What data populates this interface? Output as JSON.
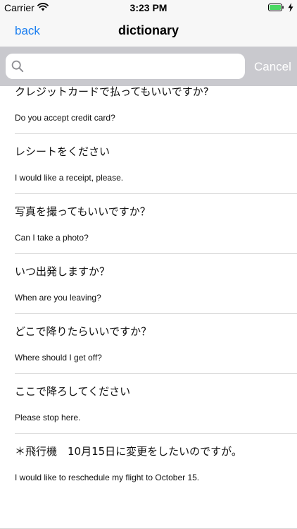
{
  "status_bar": {
    "carrier": "Carrier",
    "time": "3:23 PM"
  },
  "nav": {
    "back_label": "back",
    "title": "dictionary"
  },
  "search": {
    "value": "",
    "placeholder": "",
    "cancel_label": "Cancel"
  },
  "phrases": [
    {
      "jp": "クレジットカードで払ってもいいですか?",
      "en": "Do you accept credit card?"
    },
    {
      "jp": "レシートをください",
      "en": "I would like a receipt, please."
    },
    {
      "jp": "写真を撮ってもいいですか？",
      "en": "Can I take a photo?"
    },
    {
      "jp": "いつ出発しますか？",
      "en": "When are you leaving?"
    },
    {
      "jp": "どこで降りたらいいですか？",
      "en": "Where should I get off?"
    },
    {
      "jp": "ここで降ろしてください",
      "en": "Please stop here."
    },
    {
      "jp": "＊飛行機　10月15日に変更をしたいのですが。",
      "en": "I would like to reschedule my flight to October 15."
    }
  ],
  "colors": {
    "accent": "#1a7ef0",
    "battery": "#4cd964",
    "search_bar_bg": "#c9c9ce"
  },
  "icons": {
    "wifi": "wifi-icon",
    "battery": "battery-icon",
    "charging": "charging-icon",
    "search": "search-icon"
  }
}
